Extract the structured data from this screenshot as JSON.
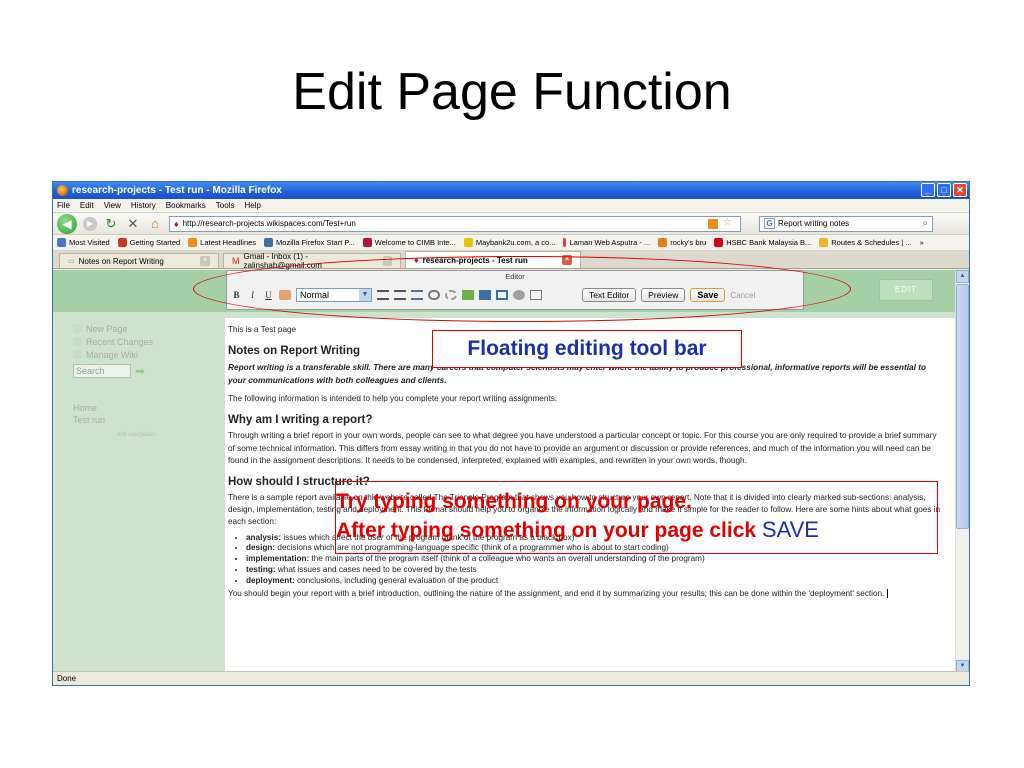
{
  "slide": {
    "title": "Edit Page Function"
  },
  "window": {
    "title": "research-projects - Test run - Mozilla Firefox"
  },
  "menu": [
    "File",
    "Edit",
    "View",
    "History",
    "Bookmarks",
    "Tools",
    "Help"
  ],
  "navbar": {
    "url": "http://research-projects.wikispaces.com/Test+run",
    "search": "Report writing notes"
  },
  "bookmarks": [
    {
      "label": "Most Visited",
      "color": "#4a76c9"
    },
    {
      "label": "Getting Started",
      "color": "#c73a1c"
    },
    {
      "label": "Latest Headlines",
      "color": "#f08c1c"
    },
    {
      "label": "Mozilla Firefox Start P...",
      "color": "#3a6ea5"
    },
    {
      "label": "Welcome to CIMB Inte...",
      "color": "#b5123a"
    },
    {
      "label": "Maybank2u.com, a co...",
      "color": "#e5c300"
    },
    {
      "label": "Laman Web Asputra - ...",
      "color": "#d44"
    },
    {
      "label": "rocky's bru",
      "color": "#e87b1a"
    },
    {
      "label": "HSBC Bank Malaysia B...",
      "color": "#d0021b"
    },
    {
      "label": "Routes & Schedules | ...",
      "color": "#f0b429"
    }
  ],
  "bookmarks_more": "»",
  "tabs": [
    {
      "label": "Notes on Report Writing",
      "active": false
    },
    {
      "label": "Gmail - Inbox (1) - zalinshah@gmail.com",
      "active": false
    },
    {
      "label": "research-projects - Test run",
      "active": true
    }
  ],
  "editor": {
    "title": "Editor",
    "bold": "B",
    "italic": "I",
    "underline": "U",
    "format": "Normal",
    "text_editor": "Text Editor",
    "preview": "Preview",
    "save": "Save",
    "cancel": "Cancel"
  },
  "edit_button": "EDIT",
  "sidebar": {
    "new_page": "New Page",
    "recent_changes": "Recent Changes",
    "manage_wiki": "Manage Wiki",
    "search_placeholder": "Search",
    "home": "Home",
    "test_run": "Test run",
    "edit_navigation": "edit navigation"
  },
  "page": {
    "line1": "This is a Test page",
    "h1": "Notes on Report Writing",
    "intro": "Report writing is a transferable skill. There are many careers that computer scientists may enter where the ability to produce professional, informative reports will be essential to your communications with both colleagues and clients.",
    "p1": "The following information is intended to help you complete your report writing assignments.",
    "h2": "Why am I writing a report?",
    "p2": "Through writing a brief report in your own words, people can see to what degree you have understood a particular concept or topic. For this course you are only required to provide a brief summary of some technical information. This differs from essay writing in that you do not have to provide an argument or discussion or provide references, and much of the information you will need can be found in the assignment descriptions. It needs to be condensed, interpreted, explained with examples, and rewritten in your own words, though.",
    "h3": "How should I structure it?",
    "p3": "There is a sample report available on this website called The Triangle Program that shows you how to structure your own report. Note that it is divided into clearly marked sub-sections: analysis, design, implementation, testing and deployment. This format should help you to organize the information logically and make it simple for the reader to follow. Here are some hints about what goes in each section:",
    "bullets": [
      {
        "term": "analysis:",
        "text_a": " issues which affect the ",
        "em": "user",
        "text_b": " of the program (think of the program as a black box)"
      },
      {
        "term": "design:",
        "text_a": " decisions which are not programming-language specific (think of a programmer who is about to start coding)",
        "em": "",
        "text_b": ""
      },
      {
        "term": "implementation:",
        "text_a": " the main parts of the program itself (think of a colleague who wants an overall understanding of the program)",
        "em": "",
        "text_b": ""
      },
      {
        "term": "testing:",
        "text_a": " what issues and cases need to be covered by the tests",
        "em": "",
        "text_b": ""
      },
      {
        "term": "deployment:",
        "text_a": " conclusions, including general evaluation of the product",
        "em": "",
        "text_b": ""
      }
    ],
    "p4": "You should begin your report with a brief introduction, outlining the nature of the assignment, and end it by summarizing your results; this can be done within the 'deployment' section."
  },
  "status": "Done",
  "annotations": {
    "toolbar_label": "Floating editing tool bar",
    "try_line1": "Try typing something on your page.",
    "try_line2": "After typing something on your page click ",
    "try_save": "SAVE"
  }
}
